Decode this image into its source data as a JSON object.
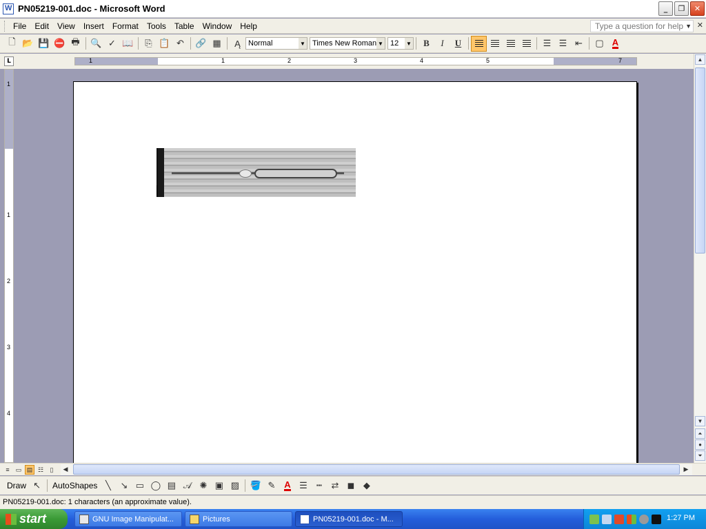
{
  "window": {
    "title": "PN05219-001.doc - Microsoft Word",
    "minimize_glyph": "_",
    "restore_glyph": "❐",
    "close_glyph": "✕"
  },
  "menu": {
    "items": [
      "File",
      "Edit",
      "View",
      "Insert",
      "Format",
      "Tools",
      "Table",
      "Window",
      "Help"
    ],
    "help_placeholder": "Type a question for help"
  },
  "formatting": {
    "style": "Normal",
    "font": "Times New Roman",
    "size": "12",
    "bold": "B",
    "italic": "I",
    "underline": "U",
    "font_color_label": "A"
  },
  "ruler": {
    "corner_label": "L",
    "h_numbers": [
      "1",
      "1",
      "2",
      "3",
      "4",
      "5",
      "7"
    ],
    "v_numbers": [
      "1",
      "1",
      "2",
      "3",
      "4"
    ]
  },
  "drawing": {
    "draw_label": "Draw",
    "autoshapes_label": "AutoShapes",
    "font_color_label": "A"
  },
  "status": {
    "text": "PN05219-001.doc: 1 characters (an approximate value)."
  },
  "taskbar": {
    "start_label": "start",
    "tasks": [
      "GNU Image Manipulat...",
      "Pictures",
      "PN05219-001.doc - M..."
    ],
    "clock": "1:27 PM"
  },
  "colors": {
    "accent_active": "#ffc66a",
    "taskbar_blue": "#245edb",
    "start_green": "#3a9a36",
    "workspace": "#9c9cb4"
  }
}
